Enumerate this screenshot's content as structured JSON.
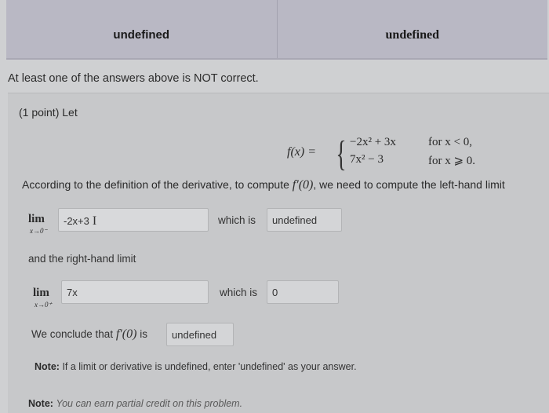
{
  "previous_answers": {
    "left_answer": "undefined",
    "right_answer": "undefined"
  },
  "warning_text": "At least one of the answers above is NOT correct.",
  "problem": {
    "header": "(1 point) Let",
    "function": {
      "name": "f(x) =",
      "row1_expr": "−2x² + 3x",
      "row1_cond": "for x < 0,",
      "row2_expr": "7x² − 3",
      "row2_cond": "for x ⩾ 0."
    },
    "definition_text": "According to the definition of the derivative, to compute",
    "definition_symbol": "f′(0)",
    "definition_text_2": ", we need to compute the left-hand limit",
    "left_limit": {
      "lim_label": "lim",
      "lim_sub": "x→0⁻",
      "input_value": "-2x+3",
      "which_is": "which is",
      "value": "undefined"
    },
    "right_hand_text": "and the right-hand limit",
    "right_limit": {
      "lim_label": "lim",
      "lim_sub": "x→0⁺",
      "input_value": "7x",
      "which_is": "which is",
      "value": "0"
    },
    "conclusion_text": "We conclude that",
    "conclusion_symbol": "f′(0)",
    "conclusion_is": "is",
    "conclusion_value": "undefined",
    "note1_label": "Note:",
    "note1_text": "If a limit or derivative is undefined, enter 'undefined' as your answer.",
    "note2_label": "Note:",
    "note2_text": "You can earn partial credit on this problem."
  }
}
